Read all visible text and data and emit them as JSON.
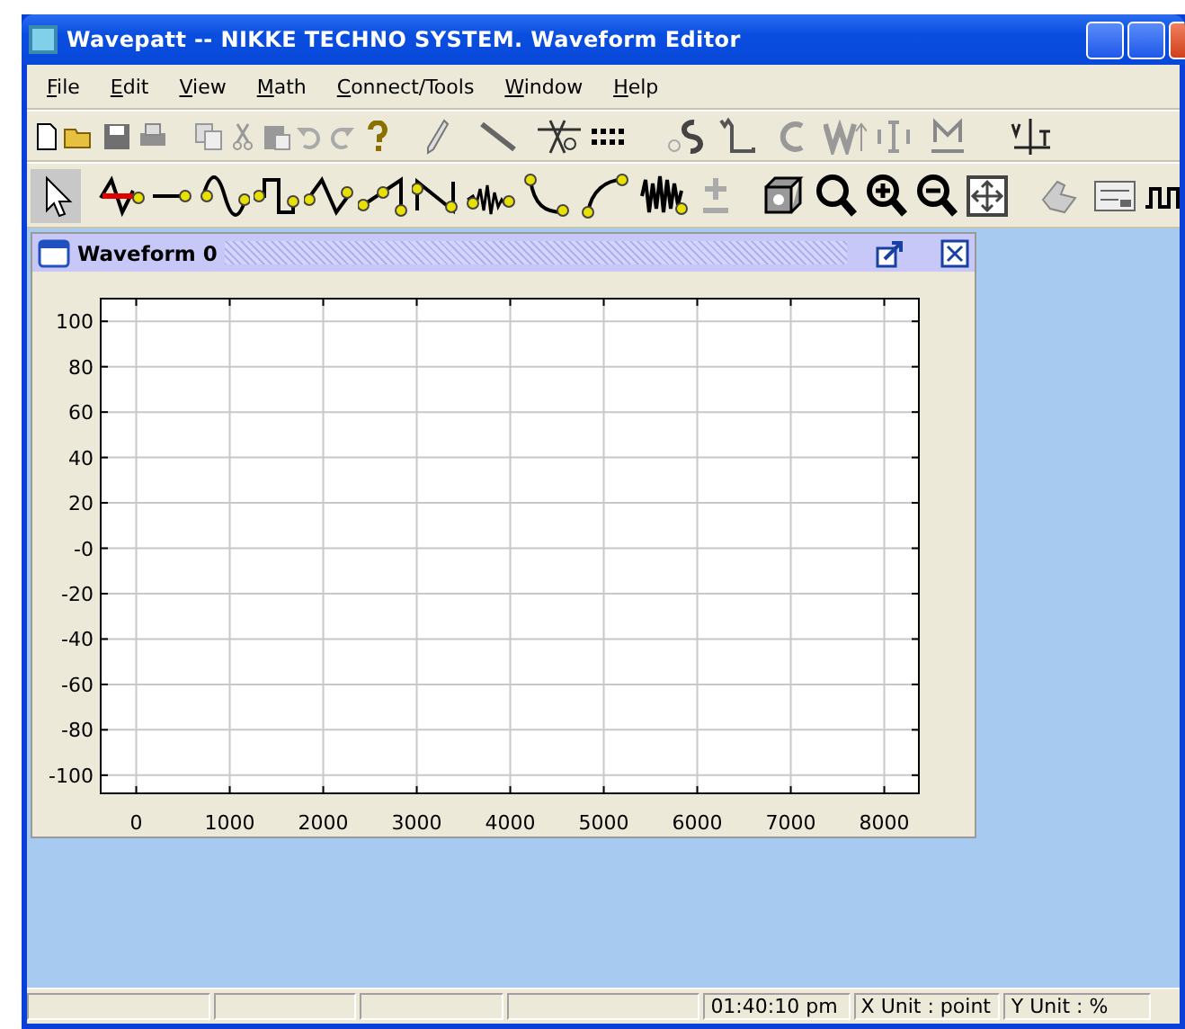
{
  "window": {
    "title": "Wavepatt -- NIKKE TECHNO SYSTEM. Waveform Editor"
  },
  "menu": [
    "File",
    "Edit",
    "View",
    "Math",
    "Connect/Tools",
    "Window",
    "Help"
  ],
  "document": {
    "title": "Waveform 0",
    "chart_data": {
      "type": "line",
      "grid": true,
      "xlim": [
        -380,
        8370
      ],
      "ylim": [
        -108,
        110
      ],
      "xticks": [
        0,
        1000,
        2000,
        3000,
        4000,
        5000,
        6000,
        7000,
        8000
      ],
      "yticks": [
        100,
        80,
        60,
        40,
        20,
        {
          "value": 0,
          "label": "-0"
        },
        -20,
        -40,
        -60,
        -80,
        -100
      ]
    }
  },
  "status_bar": {
    "time": "01:40:10 pm",
    "x_unit": "X Unit : point",
    "y_unit": "Y Unit : %"
  }
}
